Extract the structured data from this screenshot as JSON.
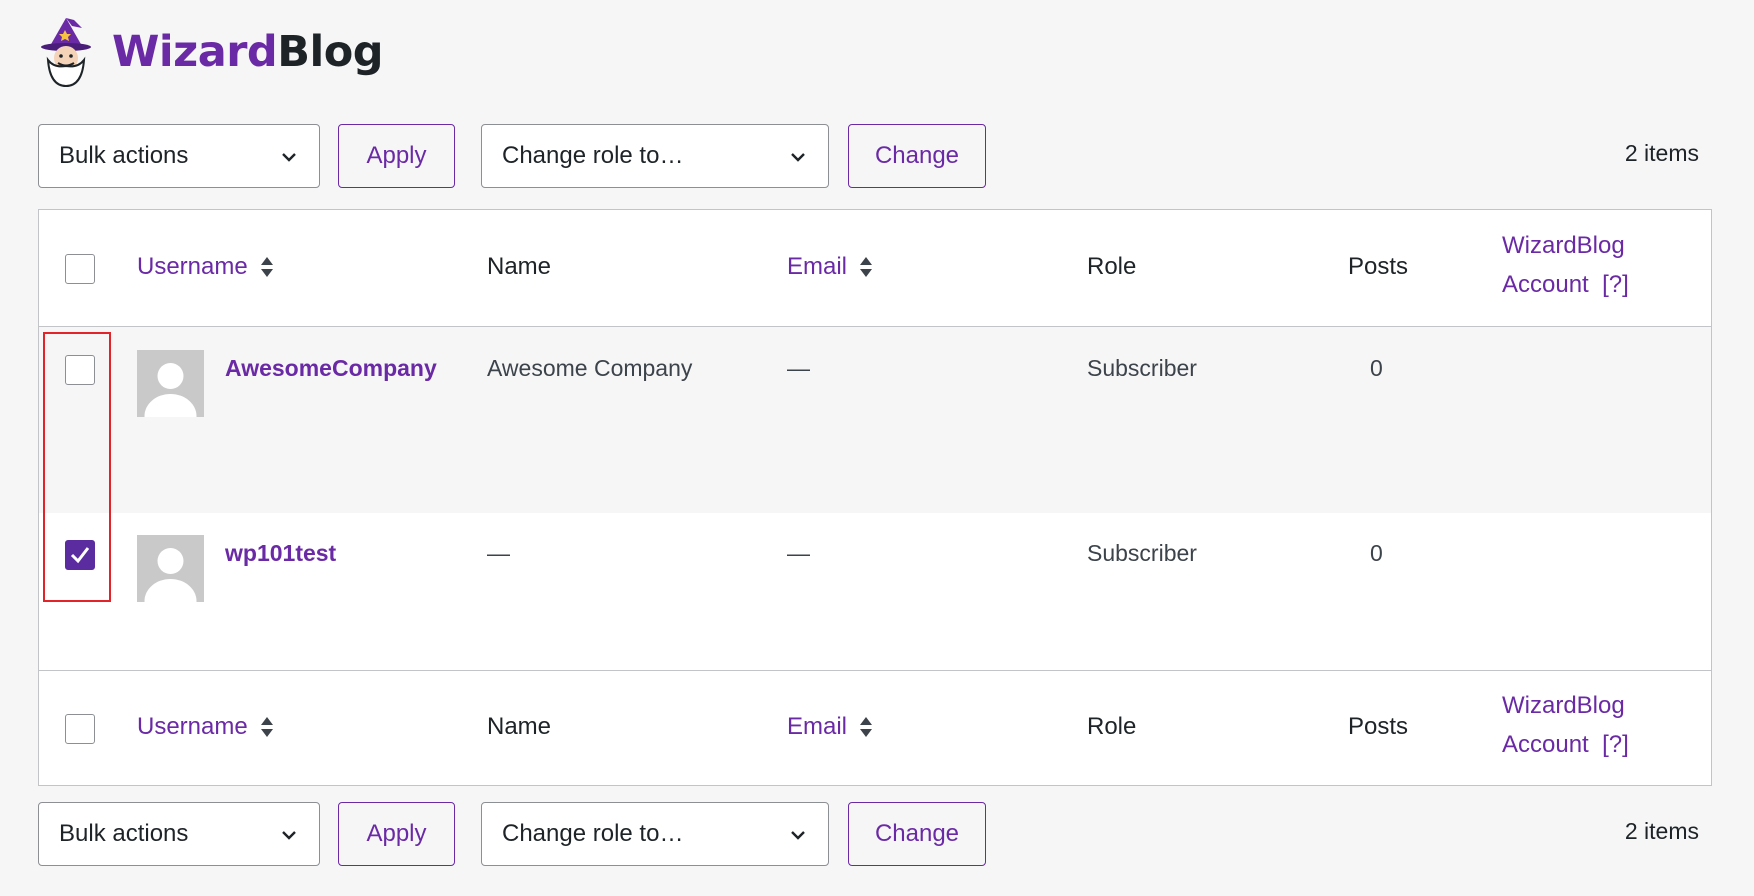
{
  "brand": {
    "name_part1": "Wizard",
    "name_part2": "Blog",
    "logo_icon": "wizard-icon"
  },
  "toolbar": {
    "bulk_actions_label": "Bulk actions",
    "apply_label": "Apply",
    "change_role_label": "Change role to…",
    "change_label": "Change",
    "items_count": "2 items"
  },
  "table": {
    "columns": {
      "username": "Username",
      "name": "Name",
      "email": "Email",
      "role": "Role",
      "posts": "Posts",
      "account_line1": "WizardBlog",
      "account_line2": "Account",
      "account_help": "[?]"
    },
    "rows": [
      {
        "username": "AwesomeCompany",
        "name": "Awesome Company",
        "email": "—",
        "role": "Subscriber",
        "posts": "0",
        "checked": false
      },
      {
        "username": "wp101test",
        "name": "—",
        "email": "—",
        "role": "Subscriber",
        "posts": "0",
        "checked": true
      }
    ]
  },
  "colors": {
    "accent": "#6b2aa5",
    "checkbox_checked": "#5b2ba0",
    "highlight": "#e1242a"
  }
}
